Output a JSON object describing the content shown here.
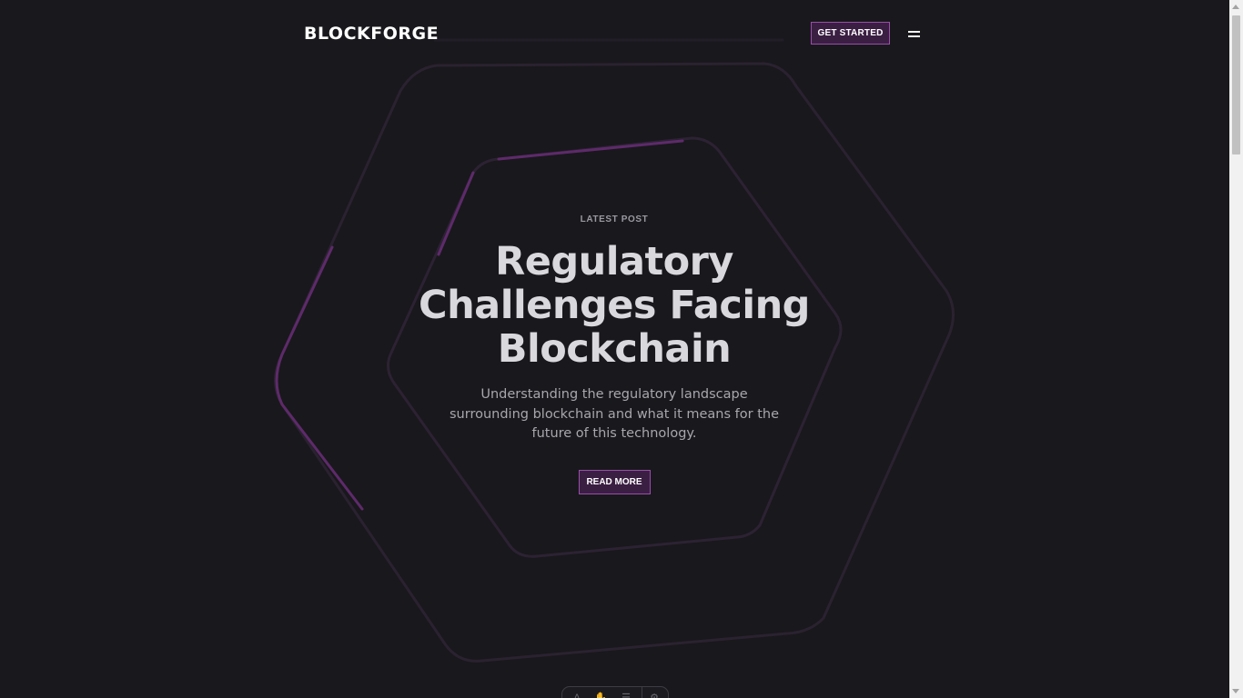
{
  "brand": {
    "name": "BLOCKFORGE"
  },
  "header": {
    "cta_label": "GET STARTED",
    "menu_icon": "hamburger-menu-icon"
  },
  "hero": {
    "eyebrow": "LATEST POST",
    "title_lines": [
      "Regulatory",
      "Challenges Facing",
      "Blockchain"
    ],
    "subtitle": "Understanding the regulatory landscape surrounding blockchain and what it means for the future of this technology.",
    "read_more_label": "READ MORE"
  },
  "toolbar": {
    "icons": [
      "text-icon",
      "hand-icon",
      "list-icon",
      "settings-icon"
    ]
  },
  "colors": {
    "background": "#19181c",
    "accent": "#9b4dad",
    "accent_fill": "#3a1f42",
    "hex_outline": "#2c2233",
    "hex_highlight": "#5e2a6b"
  }
}
